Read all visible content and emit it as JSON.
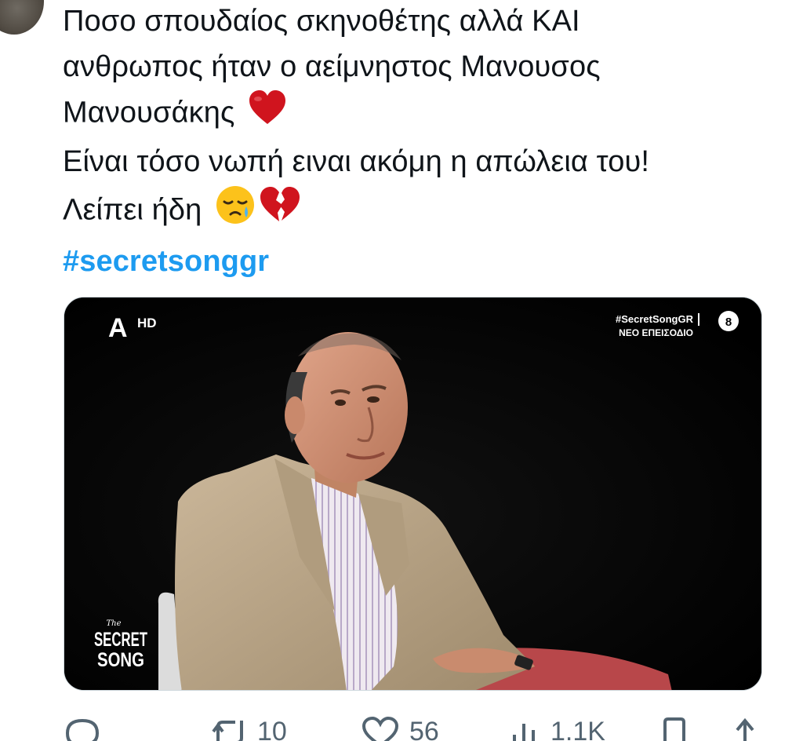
{
  "tweet": {
    "lines": [
      "Ποσο σπουδαίος σκηνοθέτης  αλλά ΚΑΙ",
      "ανθρωπος ήταν ο αείμνηστος Μανουσος",
      "Μανουσάκης",
      "Είναι τόσο νωπή ειναι ακόμη η απώλεια του!",
      "Λείπει ήδη"
    ],
    "hashtag": "#secretsonggr",
    "emojis": [
      "red-heart",
      "sad-relieved-face",
      "broken-heart"
    ]
  },
  "media": {
    "channel_logo": "Α",
    "channel_quality": "HD",
    "show_hashtag": "#SecretSongGR",
    "episode_label": "ΝΕΟ ΕΠΕΙΣΟΔΙΟ",
    "rating_badge": "8",
    "show_logo_small": "The",
    "show_logo_line1": "SECRET",
    "show_logo_line2": "SONG"
  },
  "actions": {
    "retweets": "10",
    "likes": "56",
    "views": "1.1K"
  },
  "colors": {
    "text": "#0f1419",
    "hashtag": "#1d9bf0",
    "muted": "#536471",
    "heart": "#d0141e"
  }
}
